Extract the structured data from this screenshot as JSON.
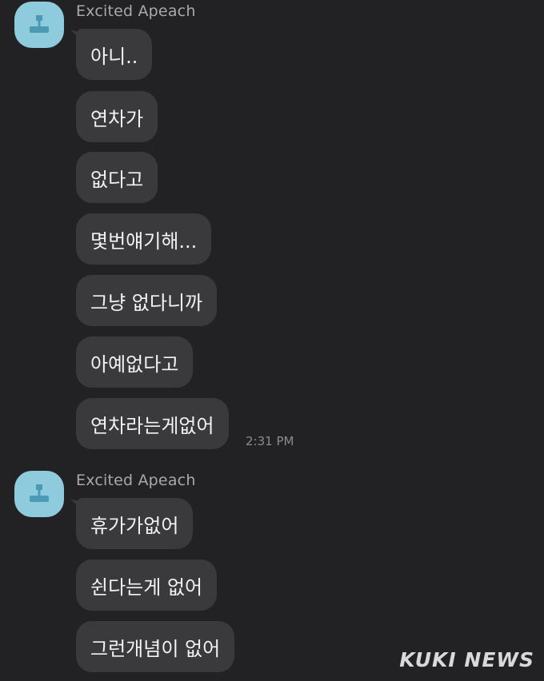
{
  "conversation": {
    "groups": [
      {
        "sender": "Excited Apeach",
        "avatar_icon": "apeach-avatar-icon",
        "messages": [
          "아니..",
          "연차가",
          "없다고",
          "몇번얘기해...",
          "그냥 없다니까",
          "아예없다고",
          "연차라는게없어"
        ],
        "time": "2:31 PM"
      },
      {
        "sender": "Excited Apeach",
        "avatar_icon": "apeach-avatar-icon",
        "messages": [
          "휴가가없어",
          "쉰다는게 없어",
          "그런개념이 없어"
        ],
        "time": ""
      }
    ]
  },
  "watermark": "KUKI NEWS",
  "colors": {
    "background": "#222224",
    "bubble": "#3a3a3d",
    "avatar": "#8ecbdc",
    "text": "#f2f2f2"
  }
}
